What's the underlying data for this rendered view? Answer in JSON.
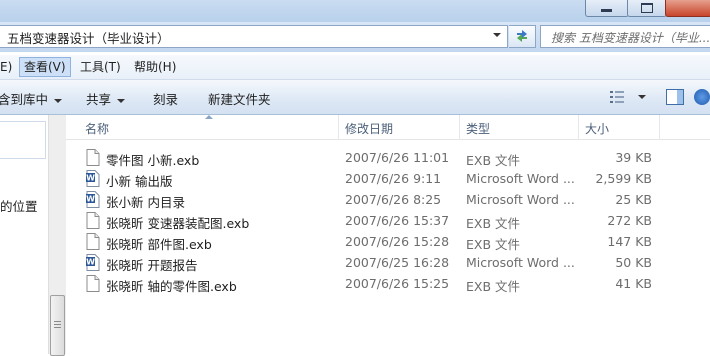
{
  "window": {
    "address_path": "五档变速器设计（毕业设计）",
    "search_placeholder": "搜索 五档变速器设计（毕业..."
  },
  "menu": {
    "items": [
      {
        "label": "E)"
      },
      {
        "label": "查看(V)"
      },
      {
        "label": "工具(T)"
      },
      {
        "label": "帮助(H)"
      }
    ]
  },
  "toolbar": {
    "include_label": "含到库中",
    "share_label": "共享",
    "burn_label": "刻录",
    "new_folder_label": "新建文件夹"
  },
  "nav": {
    "item_label": "的位置"
  },
  "columns": {
    "name": "名称",
    "date": "修改日期",
    "type": "类型",
    "size": "大小"
  },
  "files": [
    {
      "name": "零件图 小新.exb",
      "date": "2007/6/26 11:01",
      "type": "EXB 文件",
      "size": "39 KB",
      "icon": "generic-file-icon"
    },
    {
      "name": "小新 输出版",
      "date": "2007/6/26 9:11",
      "type": "Microsoft Word ...",
      "size": "2,599 KB",
      "icon": "word-doc-icon"
    },
    {
      "name": "张小新 内目录",
      "date": "2007/6/26 8:25",
      "type": "Microsoft Word ...",
      "size": "25 KB",
      "icon": "word-doc-icon"
    },
    {
      "name": "张晓昕  变速器装配图.exb",
      "date": "2007/6/26 15:37",
      "type": "EXB 文件",
      "size": "272 KB",
      "icon": "generic-file-icon"
    },
    {
      "name": "张晓昕  部件图.exb",
      "date": "2007/6/26 15:28",
      "type": "EXB 文件",
      "size": "147 KB",
      "icon": "generic-file-icon"
    },
    {
      "name": "张晓昕  开题报告",
      "date": "2007/6/25 16:28",
      "type": "Microsoft Word ...",
      "size": "50 KB",
      "icon": "word-doc-icon"
    },
    {
      "name": "张晓昕 轴的零件图.exb",
      "date": "2007/6/26 15:25",
      "type": "EXB 文件",
      "size": "41 KB",
      "icon": "generic-file-icon"
    }
  ],
  "colors": {
    "menu_active": "#cde0f7",
    "header_text": "#4c607a",
    "secondary_text": "#6d6d6d",
    "word_icon_blue": "#2b5797"
  }
}
